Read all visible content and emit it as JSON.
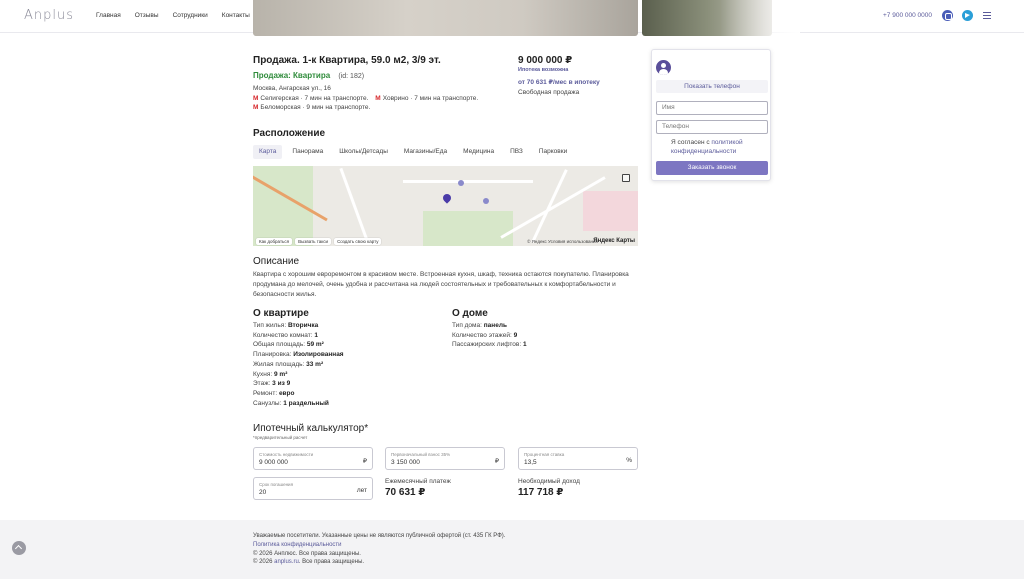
{
  "header": {
    "logo": "Anplus",
    "nav": [
      "Главная",
      "Отзывы",
      "Сотрудники",
      "Контакты"
    ],
    "phone": "+7 900 000 0000",
    "icons": [
      "vk-icon",
      "telegram-icon",
      "menu-icon"
    ]
  },
  "listing": {
    "title": "Продажа. 1-к Квартира, 59.0 м2, 3/9 эт.",
    "type": "Продажа: Квартира",
    "id": "(id: 182)",
    "address": "Москва, Ангарская ул., 16",
    "metro": [
      "Селигерская · 7 мин на транспорте.",
      "Ховрино · 7 мин на транспорте.",
      "Беломорская · 9 мин на транспорте."
    ],
    "price": "9 000 000 ₽",
    "mortgage_note": "Ипотека возможна",
    "mortgage_month": "от 70 631 ₽/мес в ипотеку",
    "sale_type": "Свободная продажа"
  },
  "form": {
    "show_phone": "Показать телефон",
    "name_placeholder": "Имя",
    "phone_placeholder": "Телефон",
    "agree_text": "Я согласен с ",
    "agree_link": "политикой конфиденциальности",
    "call_button": "Заказать звонок"
  },
  "location": {
    "heading": "Расположение",
    "tabs": [
      "Карта",
      "Панорама",
      "Школы/Детсады",
      "Магазины/Еда",
      "Медицина",
      "ПВЗ",
      "Парковки"
    ],
    "map_bar": [
      "Как добраться",
      "Вызвать такси",
      "Создать свою карту"
    ],
    "map_attr": "© Яндекс  Условия использования",
    "map_logo": "Яндекс Карты"
  },
  "description": {
    "heading": "Описание",
    "text": "Квартира с хорошим евроремонтом в красивом месте. Встроенная кухня, шкаф, техника остаются покупателю. Планировка продумана до мелочей, очень удобна и рассчитана на людей состоятельных и требовательных к комфортабельности и безопасности жилья."
  },
  "apartment": {
    "heading": "О квартире",
    "rows": [
      {
        "k": "Тип жилья: ",
        "v": "Вторичка"
      },
      {
        "k": "Количество комнат: ",
        "v": "1"
      },
      {
        "k": "Общая площадь: ",
        "v": "59 m²"
      },
      {
        "k": "Планировка: ",
        "v": "Изолированная"
      },
      {
        "k": "Жилая площадь: ",
        "v": "33 m²"
      },
      {
        "k": "Кухня: ",
        "v": "9 m²"
      },
      {
        "k": "Этаж: ",
        "v": "3 из 9"
      },
      {
        "k": "Ремонт: ",
        "v": "евро"
      },
      {
        "k": "Санузлы: ",
        "v": "1 раздельный"
      }
    ]
  },
  "house": {
    "heading": "О доме",
    "rows": [
      {
        "k": "Тип дома: ",
        "v": "панель"
      },
      {
        "k": "Количество этажей: ",
        "v": "9"
      },
      {
        "k": "Пассажирских лифтов: ",
        "v": "1"
      }
    ]
  },
  "calculator": {
    "heading": "Ипотечный калькулятор*",
    "note": "*предварительный расчет",
    "cost_label": "Стоимость недвижимости",
    "cost_value": "9 000 000",
    "down_label": "Первоначальный взнос 35%",
    "down_value": "3 150 000",
    "rate_label": "Процентная ставка",
    "rate_value": "13,5",
    "term_label": "Срок погашения",
    "term_value": "20",
    "currency": "₽",
    "percent": "%",
    "years": "лет",
    "monthly_label": "Ежемесячный платеж",
    "monthly_value": "70 631 ₽",
    "income_label": "Необходимый доход",
    "income_value": "117 718 ₽"
  },
  "footer": {
    "notice": "Уважаемые посетители. Указанные цены не являются публичной офертой (ст. 435 ГК РФ).",
    "privacy": "Политика конфиденциальности",
    "copy1": "© 2026 Анплюс. Все права защищены.",
    "copy2_pre": "© 2026 ",
    "copy2_link": "anplus.ru",
    "copy2_post": ". Все права защищены."
  }
}
